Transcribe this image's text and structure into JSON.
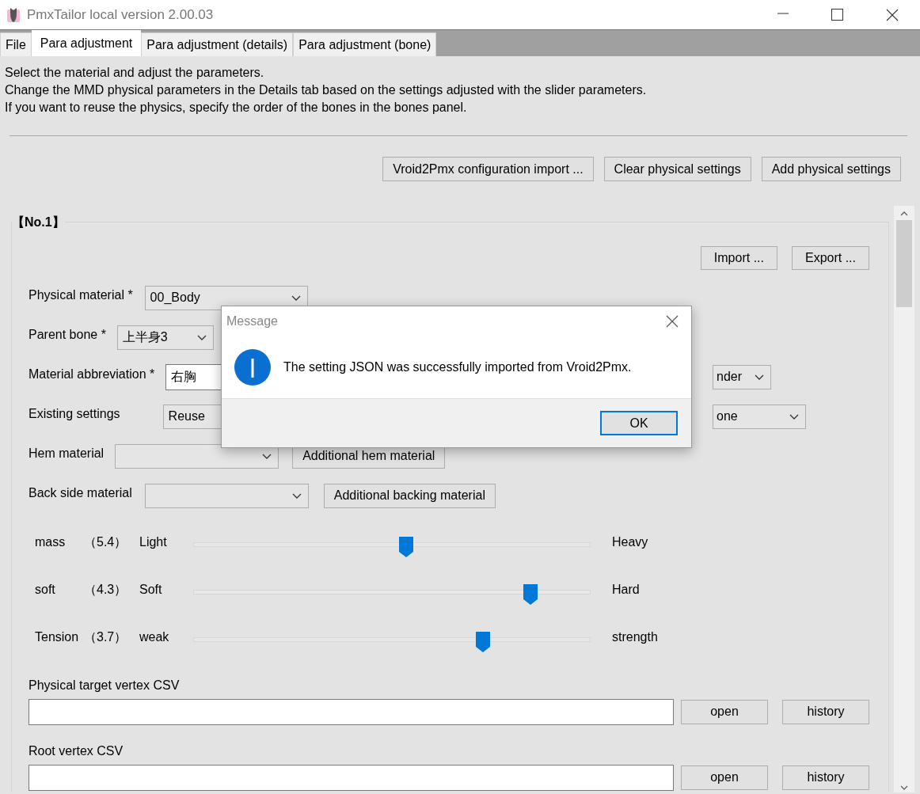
{
  "window": {
    "title": "PmxTailor local version 2.00.03"
  },
  "tabs": [
    {
      "label": "File",
      "selected": false
    },
    {
      "label": "Para adjustment",
      "selected": true
    },
    {
      "label": "Para adjustment (details)",
      "selected": false
    },
    {
      "label": "Para adjustment (bone)",
      "selected": false
    }
  ],
  "description": [
    "Select the material and adjust the parameters.",
    "Change the MMD physical parameters in the Details tab based on the settings adjusted with the slider parameters.",
    "If you want to reuse the physics, specify the order of the bones in the bones panel."
  ],
  "toolbar_buttons": [
    "Vroid2Pmx configuration import ...",
    "Clear physical settings",
    "Add physical settings"
  ],
  "group": {
    "title": "【No.1】",
    "buttons": [
      "Import ...",
      "Export ..."
    ],
    "fields": [
      {
        "kind": "dropdown",
        "label": "Physical material *",
        "value": "00_Body"
      },
      {
        "kind": "dropdown",
        "label": "Parent bone *",
        "value": "上半身3"
      },
      {
        "kind": "text",
        "label": "Material abbreviation *",
        "value": "右胸",
        "extra_dropdown": "nder"
      },
      {
        "kind": "dropdown",
        "label": "Existing settings",
        "value": "Reuse",
        "extra_dropdown": "one"
      },
      {
        "kind": "dropdown",
        "label": "Hem material",
        "button": "Additional hem material"
      },
      {
        "kind": "dropdown",
        "label": "Back side material",
        "button": "Additional backing material"
      }
    ],
    "sliders": [
      {
        "name": "mass",
        "reading": "（5.4）",
        "min_label": "Light",
        "max_label": "Heavy",
        "level": 0.536
      },
      {
        "name": "soft",
        "reading": "（4.3）",
        "min_label": "Soft",
        "max_label": "Hard",
        "level": 0.848
      },
      {
        "name": "Tension",
        "reading": "（3.7）",
        "min_label": "weak",
        "max_label": "strength",
        "level": 0.73
      }
    ],
    "csv_fields": [
      {
        "label": "Physical target vertex CSV",
        "buttons": [
          "open",
          "history"
        ]
      },
      {
        "label": "Root vertex CSV",
        "buttons": [
          "open",
          "history"
        ]
      }
    ]
  },
  "dialog": {
    "title": "Message",
    "message": "The setting JSON was successfully imported from Vroid2Pmx.",
    "buttons": [
      {
        "label": "OK",
        "selected": true
      }
    ]
  }
}
